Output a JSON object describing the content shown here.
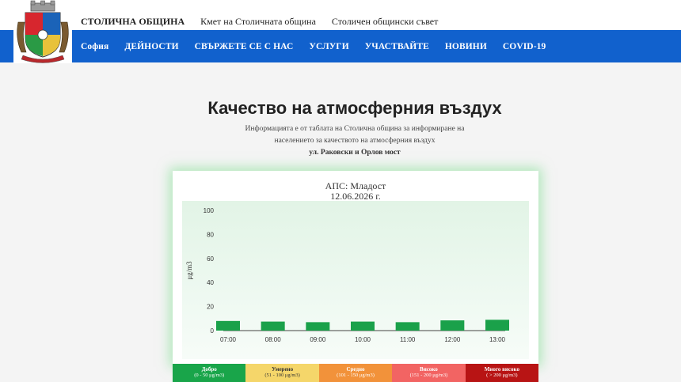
{
  "header": {
    "org_name": "СТОЛИЧНА ОБЩИНА",
    "links": [
      "Кмет на Столичната община",
      "Столичен общински съвет"
    ]
  },
  "nav": {
    "items": [
      "София",
      "ДЕЙНОСТИ",
      "СВЪРЖЕТЕ СЕ С НАС",
      "УСЛУГИ",
      "УЧАСТВАЙТЕ",
      "НОВИНИ",
      "COVID-19"
    ]
  },
  "page": {
    "title": "Качество на атмосферния въздух",
    "info_line1": "Информацията е от таблата на Столична община за информиране на",
    "info_line2": "населението за качеството на атмосферния въздух",
    "address": "ул. Раковски и Орлов мост"
  },
  "chart_data": {
    "type": "bar",
    "title": "АПС: Младост",
    "subtitle": "12.06.2026 г.",
    "ylabel": "μg/m3",
    "categories": [
      "07:00",
      "08:00",
      "09:00",
      "10:00",
      "11:00",
      "12:00",
      "13:00"
    ],
    "values": [
      8,
      7.5,
      7,
      7.5,
      7,
      8.5,
      9
    ],
    "ylim": [
      0,
      100
    ],
    "yticks": [
      0,
      20,
      40,
      60,
      80,
      100
    ],
    "bar_color": "#1aa14a",
    "grid": false
  },
  "legend": [
    {
      "label": "Добро",
      "range": "(0 - 50 μg/m3)",
      "color": "#19a54a",
      "text": "#ffffff"
    },
    {
      "label": "Умерено",
      "range": "(51 - 100 μg/m3)",
      "color": "#f5d66a",
      "text": "#333333"
    },
    {
      "label": "Средно",
      "range": "(101 - 150 μg/m3)",
      "color": "#f2923a",
      "text": "#ffffff"
    },
    {
      "label": "Високо",
      "range": "(151 - 200 μg/m3)",
      "color": "#f26463",
      "text": "#ffffff"
    },
    {
      "label": "Много високо",
      "range": "( > 200 μg/m3)",
      "color": "#b81414",
      "text": "#ffffff"
    }
  ]
}
